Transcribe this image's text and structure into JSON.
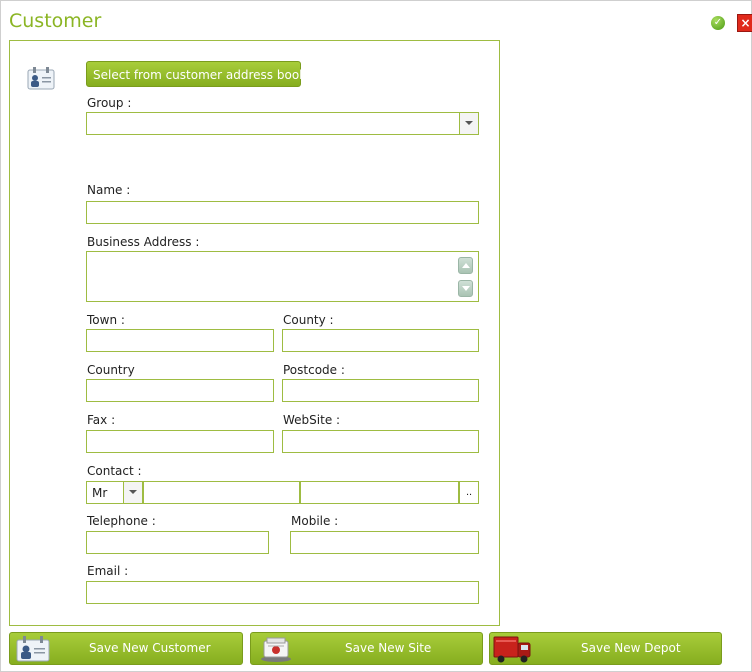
{
  "window": {
    "title": "Customer"
  },
  "buttons": {
    "select_address_book": "Select from customer address book"
  },
  "form": {
    "group_label": "Group :",
    "group_value": "",
    "name_label": "Name :",
    "name_value": "",
    "business_address_label": "Business Address :",
    "business_address_value": "",
    "town_label": "Town :",
    "town_value": "",
    "county_label": "County :",
    "county_value": "",
    "country_label": "Country",
    "country_value": "",
    "postcode_label": "Postcode :",
    "postcode_value": "",
    "fax_label": "Fax :",
    "fax_value": "",
    "website_label": "WebSite :",
    "website_value": "",
    "contact_label": "Contact :",
    "contact_title": "Mr",
    "contact_firstname": "",
    "contact_lastname": "",
    "contact_more": "..",
    "telephone_label": "Telephone :",
    "telephone_value": "",
    "mobile_label": "Mobile :",
    "mobile_value": "",
    "email_label": "Email :",
    "email_value": ""
  },
  "footer": {
    "save_customer": "Save New Customer",
    "save_site": "Save New Site",
    "save_depot": "Save New Depot"
  },
  "icons": {
    "ok": "check-circle-icon",
    "close": "close-icon",
    "contact_card": "contact-card-icon",
    "site": "rolodex-icon",
    "depot": "truck-icon"
  },
  "colors": {
    "accent": "#8bb524",
    "button": "#94bb2a",
    "field_border": "#9ebc42",
    "close": "#e02a1c"
  }
}
